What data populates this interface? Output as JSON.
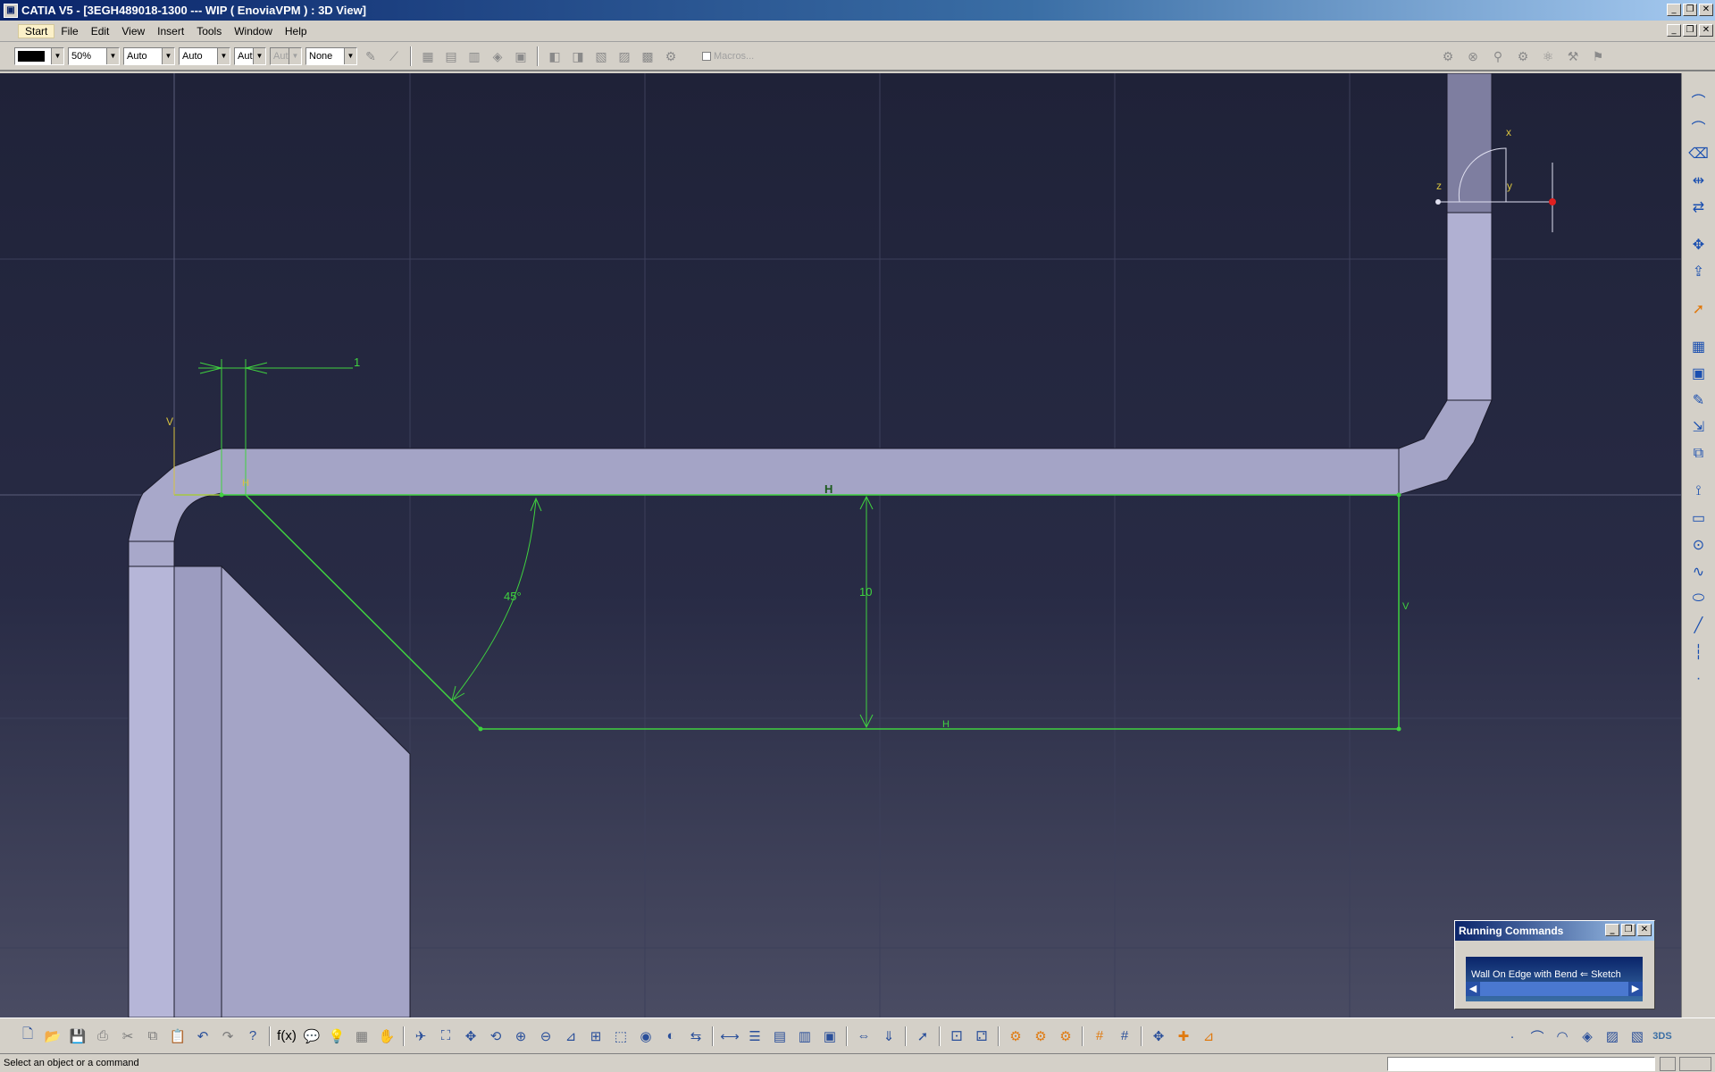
{
  "window": {
    "title": "CATIA V5 - [3EGH489018-1300 --- WIP ( EnoviaVPM ) : 3D View]",
    "controls": [
      "_",
      "❐",
      "✕"
    ]
  },
  "menu": [
    "Start",
    "File",
    "Edit",
    "View",
    "Insert",
    "Tools",
    "Window",
    "Help"
  ],
  "toolbar": {
    "color_value": "",
    "transparency": "50%",
    "line_thickness": "Auto",
    "line_type": "Auto",
    "point_type": "Aut",
    "layer_disabled": "Aut",
    "layer": "None",
    "macros_label": "Macros..."
  },
  "sketch": {
    "dim_width": "1",
    "dim_angle": "45°",
    "dim_height": "10",
    "constraint_h_top": "H",
    "constraint_h_bottom": "H",
    "constraint_h_small": "H",
    "constraint_v_right": "V",
    "constraint_v_left": "V"
  },
  "compass": {
    "x_label": "x",
    "y_label": "y",
    "z_label": "z"
  },
  "running_commands": {
    "title": "Running Commands",
    "entry": "Wall On Edge with Bend ⇐ Sketch"
  },
  "status": {
    "message": "Select an object or a command"
  },
  "colors": {
    "sketch_green": "#3fd23f",
    "part_fill": "#a7a7c9",
    "background_top": "#1f2238",
    "background_bottom": "#4a4c63"
  }
}
